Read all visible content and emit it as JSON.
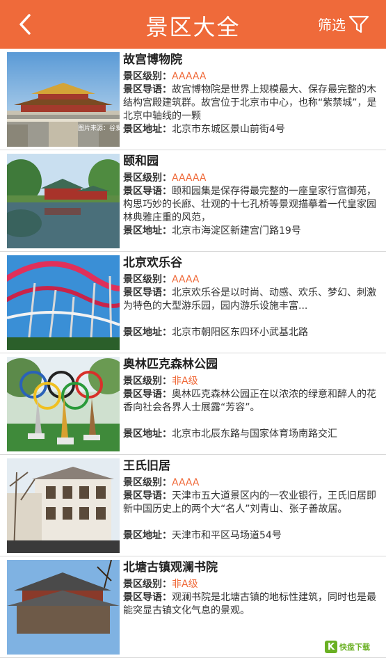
{
  "header": {
    "title": "景区大全",
    "filter_label": "筛选"
  },
  "labels": {
    "level": "景区级别：",
    "guide": "景区导语：",
    "address": "景区地址："
  },
  "spots": [
    {
      "name": "故宫博物院",
      "level": "AAAAA",
      "guide": "故宫博物院是世界上规模最大、保存最完整的木结构宫殿建筑群。故宫位于北京市中心，也称“紫禁城”，是北京中轴线的一颗",
      "address": "北京市东城区景山前街4号",
      "img_caption": "图片来源：谷爱凌助"
    },
    {
      "name": "颐和园",
      "level": "AAAAA",
      "guide": "颐和园集是保存得最完整的一座皇家行宫御苑，构思巧妙的长廊、壮观的十七孔桥等景观描摹着一代皇家园林典雅庄重的风范，",
      "address": "北京市海淀区新建宫门路19号"
    },
    {
      "name": "北京欢乐谷",
      "level": "AAAA",
      "guide": "北京欢乐谷是以时尚、动感、欢乐、梦幻、刺激为特色的大型游乐园，园内游乐设施丰富...",
      "address": "北京市朝阳区东四环小武基北路"
    },
    {
      "name": "奥林匹克森林公园",
      "level": "非A级",
      "guide": "奥林匹克森林公园正在以浓浓的绿意和醉人的花香向社会各界人士展露“芳容”。",
      "address": "北京市北辰东路与国家体育场南路交汇"
    },
    {
      "name": "王氏旧居",
      "level": "AAAA",
      "guide": "天津市五大道景区内的一农业银行，王氏旧居即新中国历史上的两个大“名人”刘青山、张子善故居。",
      "address": "天津市和平区马场道54号"
    },
    {
      "name": "北塘古镇观澜书院",
      "level": "非A级",
      "guide": "观澜书院是北塘古镇的地标性建筑，同时也是最能突显古镇文化气息的景观。",
      "address": ""
    }
  ],
  "watermark": {
    "brand": "快盘下载"
  }
}
